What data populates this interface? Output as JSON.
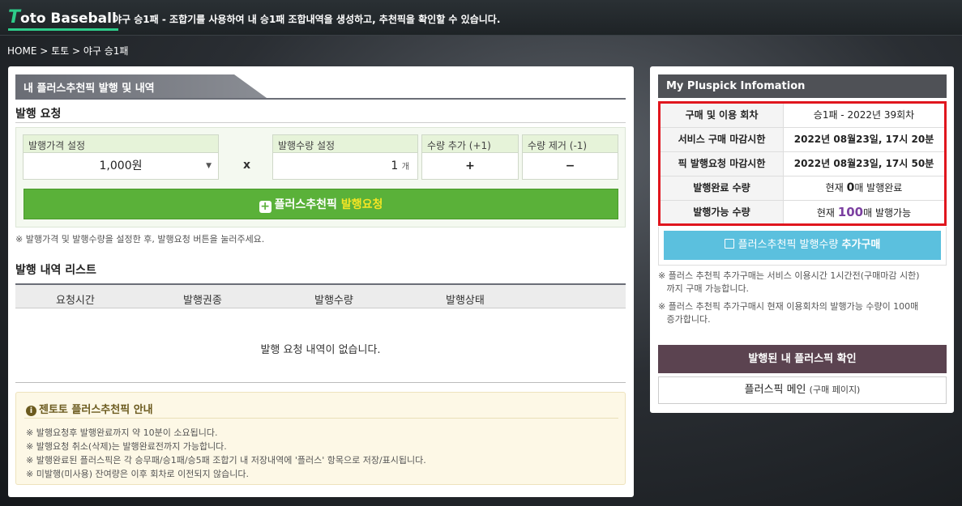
{
  "header": {
    "logo_t": "T",
    "logo_rest": "oto Baseball",
    "description": "야구 승1패 - 조합기를 사용하여 내 승1패 조합내역을 생성하고, 추천픽을 확인할 수 있습니다."
  },
  "breadcrumb": "HOME > 토토 > 야구 승1패",
  "left": {
    "panel_title": "내 플러스추천픽 발행 및 내역",
    "request_title": "발행 요청",
    "price_label": "발행가격 설정",
    "price_value": "1,000원",
    "qty_label": "발행수량 설정",
    "qty_value": "1",
    "qty_unit": "개",
    "times": "x",
    "add_label": "수량 추가 (+1)",
    "add_symbol": "+",
    "remove_label": "수량 제거 (-1)",
    "remove_symbol": "−",
    "request_btn_plus": "+",
    "request_btn_main": "플러스추천픽 ",
    "request_btn_hl": "발행요청",
    "request_note": "※ 발행가격 및 발행수량을 설정한 후, 발행요청 버튼을 눌러주세요.",
    "history_title": "발행 내역 리스트",
    "columns": [
      "요청시간",
      "발행권종",
      "발행수량",
      "발행상태"
    ],
    "empty_text": "발행 요청 내역이 없습니다.",
    "guide_title": "젠토토 플러스추천픽 안내",
    "guide_icon": "i",
    "guide_items": [
      "※ 발행요청후 발행완료까지 약 10분이 소요됩니다.",
      "※ 발행요청 취소(삭제)는 발행완료전까지 가능합니다.",
      "※ 발행완료된 플러스픽은 각 승무패/승1패/승5패 조합기 내 저장내역에 '플러스' 항목으로 저장/표시됩니다.",
      "※ 미발행(미사용) 잔여량은 이후 회차로 이전되지 않습니다."
    ]
  },
  "right": {
    "title": "My Pluspick Infomation",
    "rows": [
      {
        "key": "구매 및 이용 회차",
        "value": "승1패 - 2022년 39회차"
      },
      {
        "key": "서비스 구매 마감시한",
        "value": "2022년 08월23일, 17시 20분"
      },
      {
        "key": "픽 발행요청 마감시한",
        "value": "2022년 08월23일, 17시 50분"
      },
      {
        "key": "발행완료 수량",
        "pre": "현재 ",
        "num": "0",
        "post": "매 발행완료"
      },
      {
        "key": "발행가능 수량",
        "pre": "현재 ",
        "num": "100",
        "post": "매 발행가능"
      }
    ],
    "buy_btn_main": "플러스추천픽 발행수량 ",
    "buy_btn_bold": "추가구매",
    "notes": [
      "※ 플러스 추천픽 추가구매는 서비스 이용시간 1시간전(구매마감 시한)\n   까지 구매 가능합니다.",
      "※ 플러스 추천픽 추가구매시 현재 이용회차의 발행가능 수량이 100매\n   증가합니다."
    ],
    "issued_btn": "발행된 내 플러스픽 확인",
    "main_btn": "플러스픽 메인",
    "main_btn_sub": "(구매 페이지)"
  },
  "colors": {
    "accent_green": "#5ab139",
    "highlight_yellow": "#f5e524",
    "alert_red": "#e0161e",
    "info_blue": "#5bc0de",
    "purple_count": "#7b3fa0"
  }
}
